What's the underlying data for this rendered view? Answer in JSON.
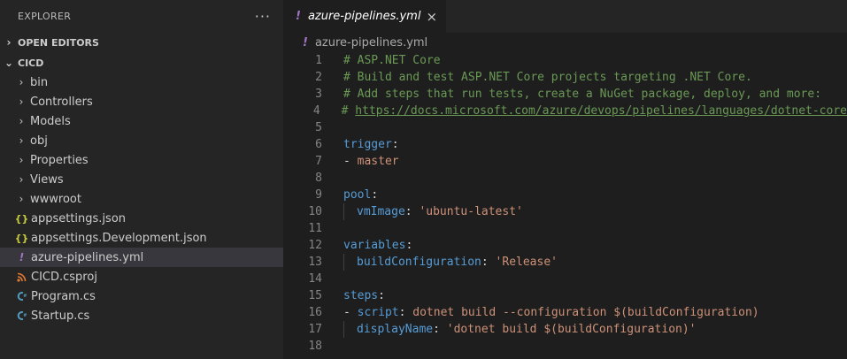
{
  "explorer": {
    "title": "EXPLORER",
    "more": "···",
    "open_editors": "OPEN EDITORS",
    "project": "CICD",
    "folders": [
      "bin",
      "Controllers",
      "Models",
      "obj",
      "Properties",
      "Views",
      "wwwroot"
    ],
    "files": [
      {
        "icon": "{}",
        "name": "appsettings.json"
      },
      {
        "icon": "{}",
        "name": "appsettings.Development.json"
      },
      {
        "icon": "!",
        "name": "azure-pipelines.yml"
      },
      {
        "icon": "rss",
        "name": "CICD.csproj"
      },
      {
        "icon": "C#",
        "name": "Program.cs"
      },
      {
        "icon": "C#",
        "name": "Startup.cs"
      }
    ]
  },
  "tab": {
    "icon": "!",
    "label": "azure-pipelines.yml",
    "close": "×"
  },
  "breadcrumb": {
    "icon": "!",
    "label": "azure-pipelines.yml"
  },
  "code": {
    "line_numbers": [
      "1",
      "2",
      "3",
      "4",
      "5",
      "6",
      "7",
      "8",
      "9",
      "10",
      "11",
      "12",
      "13",
      "14",
      "15",
      "16",
      "17",
      "18"
    ],
    "l1": "# ASP.NET Core",
    "l2": "# Build and test ASP.NET Core projects targeting .NET Core.",
    "l3": "# Add steps that run tests, create a NuGet package, deploy, and more:",
    "l4_hash": "# ",
    "l4_link": "https://docs.microsoft.com/azure/devops/pipelines/languages/dotnet-core",
    "trigger_key": "trigger",
    "colon": ":",
    "dash": "- ",
    "trigger_val": "master",
    "pool_key": "pool",
    "vmimage_key": "vmImage",
    "vmimage_val": "'ubuntu-latest'",
    "variables_key": "variables",
    "buildconf_key": "buildConfiguration",
    "buildconf_val": "'Release'",
    "steps_key": "steps",
    "script_key": "script",
    "script_val": "dotnet build --configuration $(buildConfiguration)",
    "displayname_key": "displayName",
    "displayname_val": "'dotnet build $(buildConfiguration)'"
  }
}
